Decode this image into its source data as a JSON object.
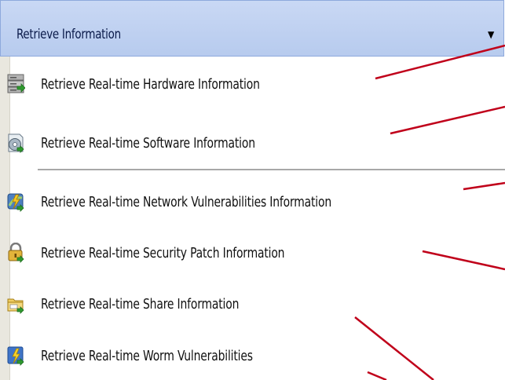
{
  "dropdown": {
    "title": "Retrieve Information",
    "arrow_icon": "dropdown-arrow-icon"
  },
  "menu": {
    "items": [
      {
        "label": "Retrieve Real-time Hardware Information",
        "icon": "server-icon"
      },
      {
        "label": "Retrieve Real-time Software Information",
        "icon": "software-disc-icon"
      },
      {
        "label": "Retrieve Real-time Network Vulnerabilities Information",
        "icon": "network-vulnerability-icon"
      },
      {
        "label": "Retrieve Real-time Security Patch Information",
        "icon": "security-patch-lock-icon"
      },
      {
        "label": "Retrieve Real-time Share Information",
        "icon": "share-folder-icon"
      },
      {
        "label": "Retrieve Real-time Worm Vulnerabilities",
        "icon": "worm-shield-icon"
      }
    ]
  },
  "colors": {
    "header_background": "#c9d8f4",
    "callout_line": "#c0001a"
  }
}
